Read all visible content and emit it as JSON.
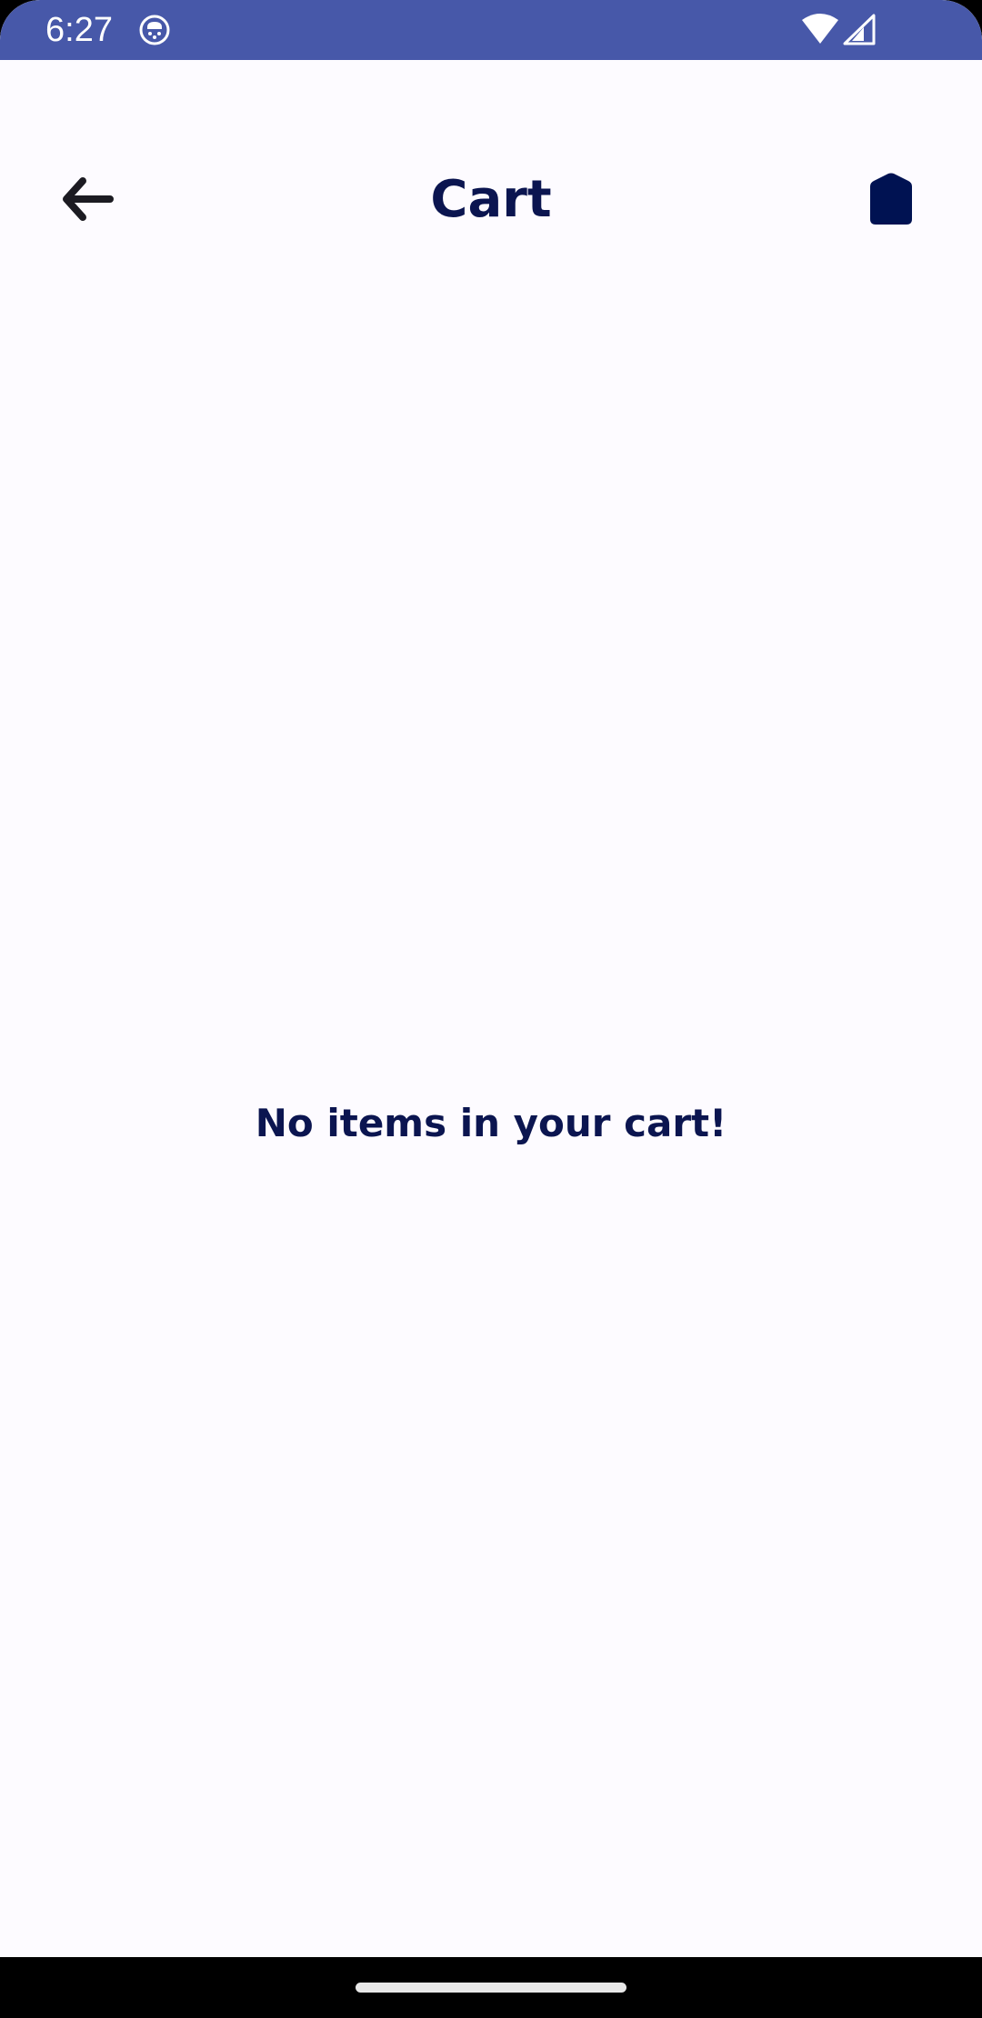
{
  "status_bar": {
    "time": "6:27",
    "background_color": "#4758a9",
    "icons": [
      "app-notification-icon",
      "wifi-icon",
      "cellular-signal-icon"
    ]
  },
  "header": {
    "title": "Cart",
    "back_icon": "arrow-back-icon",
    "home_icon": "home-icon",
    "title_color": "#0b1550"
  },
  "cart": {
    "empty_message": "No items in your cart!"
  },
  "navigation_bar": {
    "indicator": "gesture-home-indicator"
  }
}
